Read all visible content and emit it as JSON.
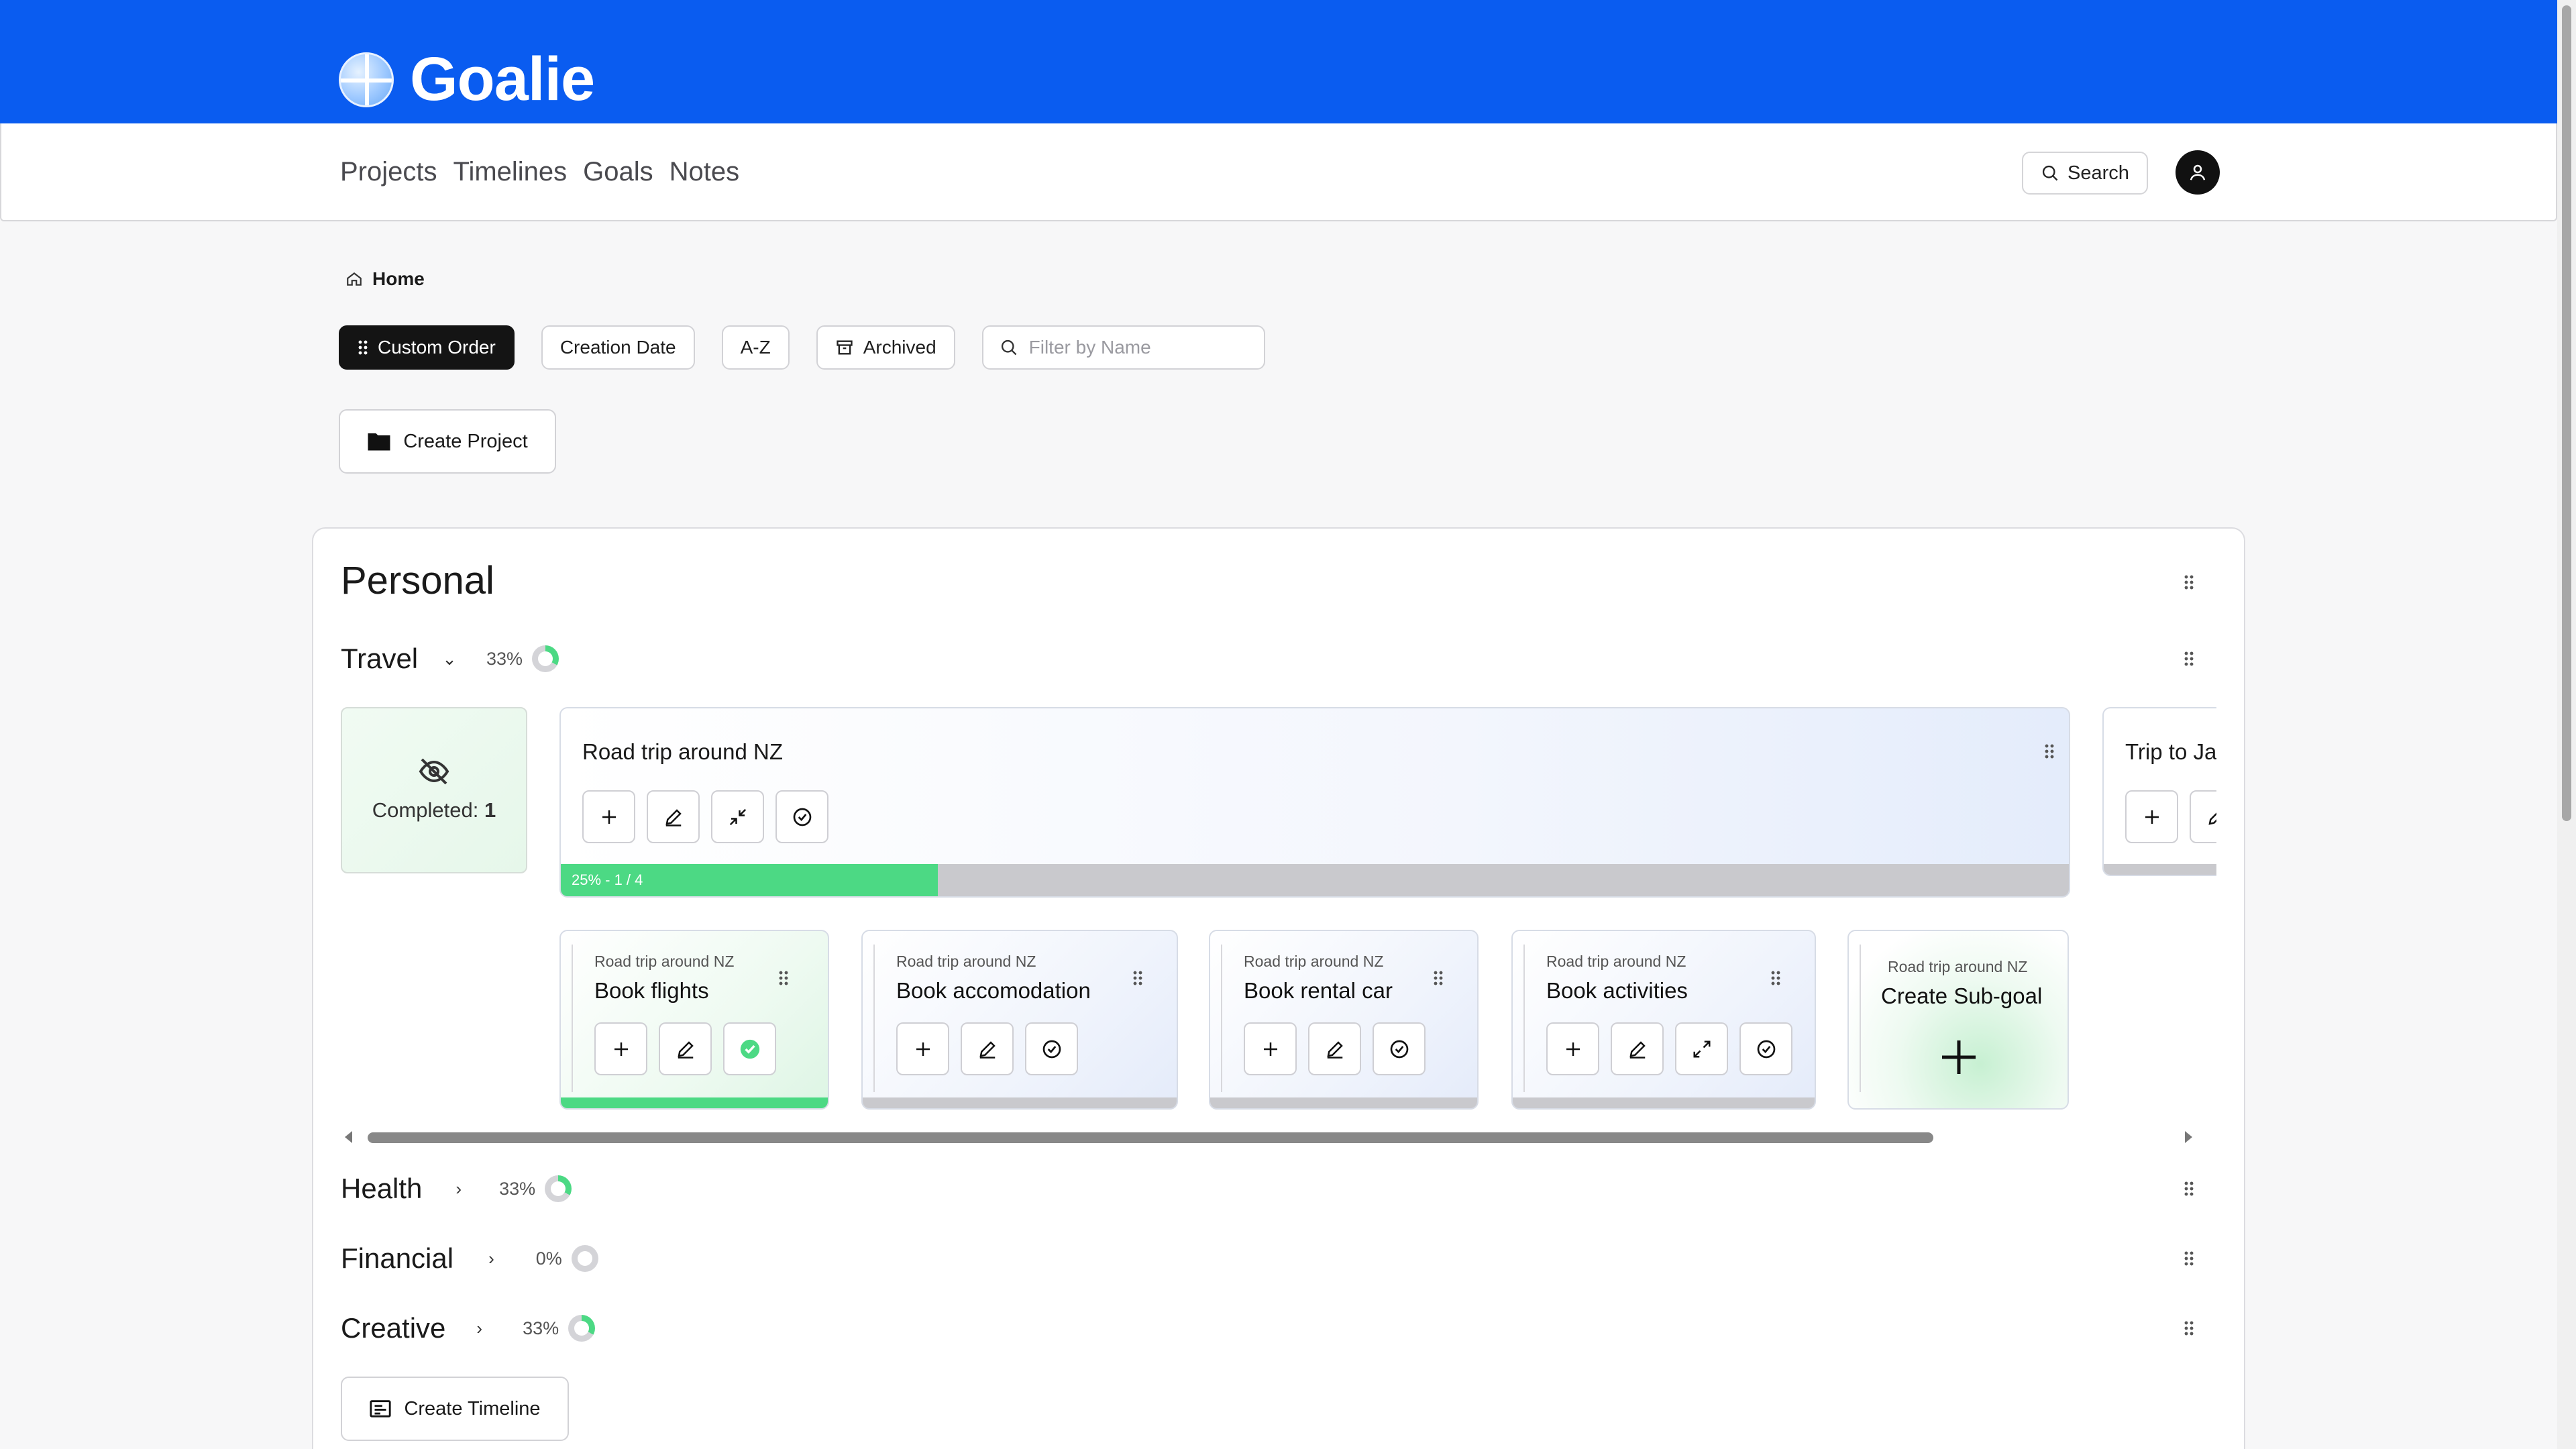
{
  "app": {
    "name": "Goalie"
  },
  "nav": {
    "links": [
      "Projects",
      "Timelines",
      "Goals",
      "Notes"
    ],
    "search_label": "Search"
  },
  "breadcrumb": {
    "home": "Home"
  },
  "filters": {
    "custom_order": "Custom Order",
    "creation_date": "Creation Date",
    "az": "A-Z",
    "archived": "Archived",
    "filter_placeholder": "Filter by Name"
  },
  "create_project_label": "Create Project",
  "project": {
    "title": "Personal",
    "timelines": [
      {
        "name": "Travel",
        "percent": "33%",
        "progress": 0.33,
        "expanded": true
      },
      {
        "name": "Health",
        "percent": "33%",
        "progress": 0.33,
        "expanded": false
      },
      {
        "name": "Financial",
        "percent": "0%",
        "progress": 0.0,
        "expanded": false
      },
      {
        "name": "Creative",
        "percent": "33%",
        "progress": 0.33,
        "expanded": false
      }
    ],
    "completed_label": "Completed:",
    "completed_count": "1",
    "goal": {
      "title": "Road trip around NZ",
      "progress_text": "25% - 1 / 4",
      "progress": 0.25
    },
    "peek_goal_title": "Trip to Ja",
    "sub_goals": [
      {
        "parent": "Road trip around NZ",
        "title": "Book flights",
        "done": true
      },
      {
        "parent": "Road trip around NZ",
        "title": "Book accomodation",
        "done": false
      },
      {
        "parent": "Road trip around NZ",
        "title": "Book rental car",
        "done": false
      },
      {
        "parent": "Road trip around NZ",
        "title": "Book activities",
        "done": false
      }
    ],
    "create_sub_goal": {
      "parent": "Road trip around NZ",
      "title": "Create Sub-goal"
    }
  },
  "create_timeline_label": "Create Timeline",
  "colors": {
    "brand": "#0a5cf0",
    "success": "#4cd984",
    "dark": "#141414"
  }
}
